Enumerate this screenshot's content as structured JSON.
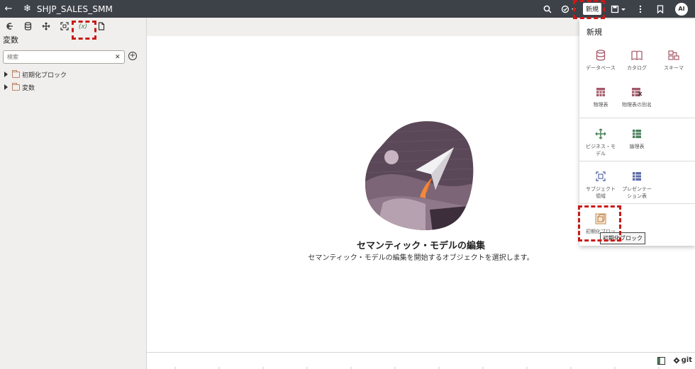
{
  "topbar": {
    "title": "SHJP_SALES_SMM",
    "new_label": "新規",
    "avatar": "AI"
  },
  "left_panel": {
    "title": "変数",
    "search_placeholder": "検索",
    "tools": [
      "back-to-list",
      "database",
      "move",
      "select",
      "(x)",
      "document"
    ],
    "active_tool_label": "(x)",
    "tree": [
      {
        "label": "初期化ブロック"
      },
      {
        "label": "変数"
      }
    ]
  },
  "main": {
    "empty_title": "セマンティック・モデルの編集",
    "empty_subtitle": "セマンティック・モデルの編集を開始するオブジェクトを選択します。"
  },
  "new_menu": {
    "title": "新規",
    "sections": [
      {
        "items": [
          {
            "label": "データベース",
            "icon": "database-icon"
          },
          {
            "label": "カタログ",
            "icon": "book-icon"
          },
          {
            "label": "スキーマ",
            "icon": "schema-icon"
          },
          {
            "label": "物理表",
            "icon": "table-icon"
          },
          {
            "label": "物理表の別名",
            "icon": "table-alias-icon"
          }
        ]
      },
      {
        "items": [
          {
            "label_line1": "ビジネス・モ",
            "label_line2": "デル",
            "icon": "move-icon"
          },
          {
            "label": "論理表",
            "icon": "logical-table-icon"
          }
        ]
      },
      {
        "items": [
          {
            "label_line1": "サブジェクト",
            "label_line2": "領域",
            "icon": "subject-area-icon"
          },
          {
            "label_line1": "プレゼンテー",
            "label_line2": "ション表",
            "icon": "presentation-table-icon"
          }
        ]
      },
      {
        "items": [
          {
            "label": "初期化ブロッ",
            "icon": "init-block-icon"
          }
        ]
      }
    ],
    "tooltip": "初期化ブロック"
  },
  "bottombar": {
    "git_label": "git"
  },
  "colors": {
    "topbar": "#3d4148",
    "panel_bg": "#f1efed",
    "accent_green": "#4c825c",
    "accent_red": "#a55a6a",
    "callout": "#c81a1a"
  }
}
